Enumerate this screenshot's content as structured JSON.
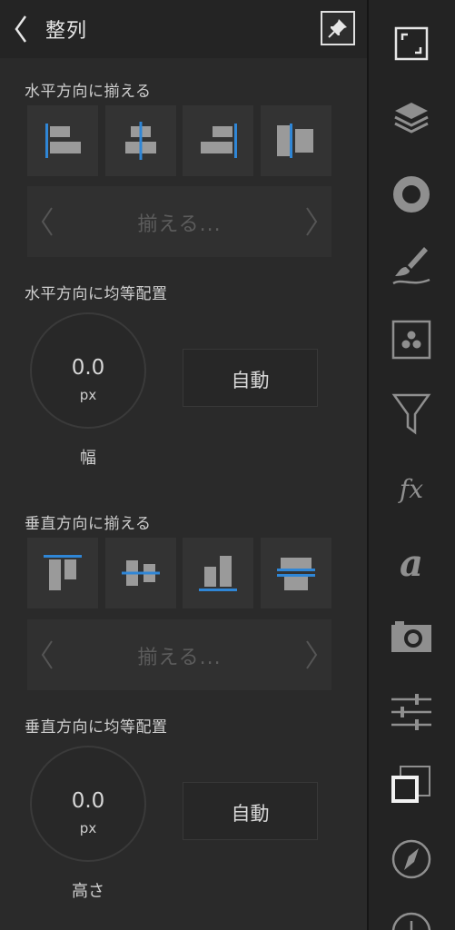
{
  "header": {
    "title": "整列",
    "back_icon": "chevron-left-icon",
    "pin_icon": "pin-icon"
  },
  "horizontal_align": {
    "label": "水平方向に揃える",
    "buttons": [
      {
        "name": "align-left-button",
        "icon": "align-left-icon"
      },
      {
        "name": "align-center-h-button",
        "icon": "align-center-horizontal-icon"
      },
      {
        "name": "align-right-button",
        "icon": "align-right-icon"
      },
      {
        "name": "align-center-overlap-h-button",
        "icon": "align-center-overlap-icon"
      }
    ],
    "selector_text": "揃える..."
  },
  "horizontal_distribute": {
    "label": "水平方向に均等配置",
    "value": "0.0",
    "unit": "px",
    "caption": "幅",
    "auto_label": "自動"
  },
  "vertical_align": {
    "label": "垂直方向に揃える",
    "buttons": [
      {
        "name": "align-top-button",
        "icon": "align-top-icon"
      },
      {
        "name": "align-middle-v-button",
        "icon": "align-middle-vertical-icon"
      },
      {
        "name": "align-bottom-button",
        "icon": "align-bottom-icon"
      },
      {
        "name": "align-center-overlap-v-button",
        "icon": "align-center-overlap-vertical-icon"
      }
    ],
    "selector_text": "揃える..."
  },
  "vertical_distribute": {
    "label": "垂直方向に均等配置",
    "value": "0.0",
    "unit": "px",
    "caption": "高さ",
    "auto_label": "自動"
  },
  "toolbar": {
    "fx_label": "fx",
    "text_label": "a",
    "items": [
      "canvas-size-icon",
      "layers-icon",
      "color-wheel-icon",
      "brush-icon",
      "pattern-icon",
      "filter-icon",
      "fx-icon",
      "text-icon",
      "camera-icon",
      "adjustments-icon",
      "arrange-icon",
      "compass-icon",
      "history-icon"
    ]
  },
  "colors": {
    "accent": "#2f86d6",
    "background": "#2a2a2a",
    "toolbar": "#232323",
    "tile": "#333333",
    "icon": "#9a9a9a"
  }
}
